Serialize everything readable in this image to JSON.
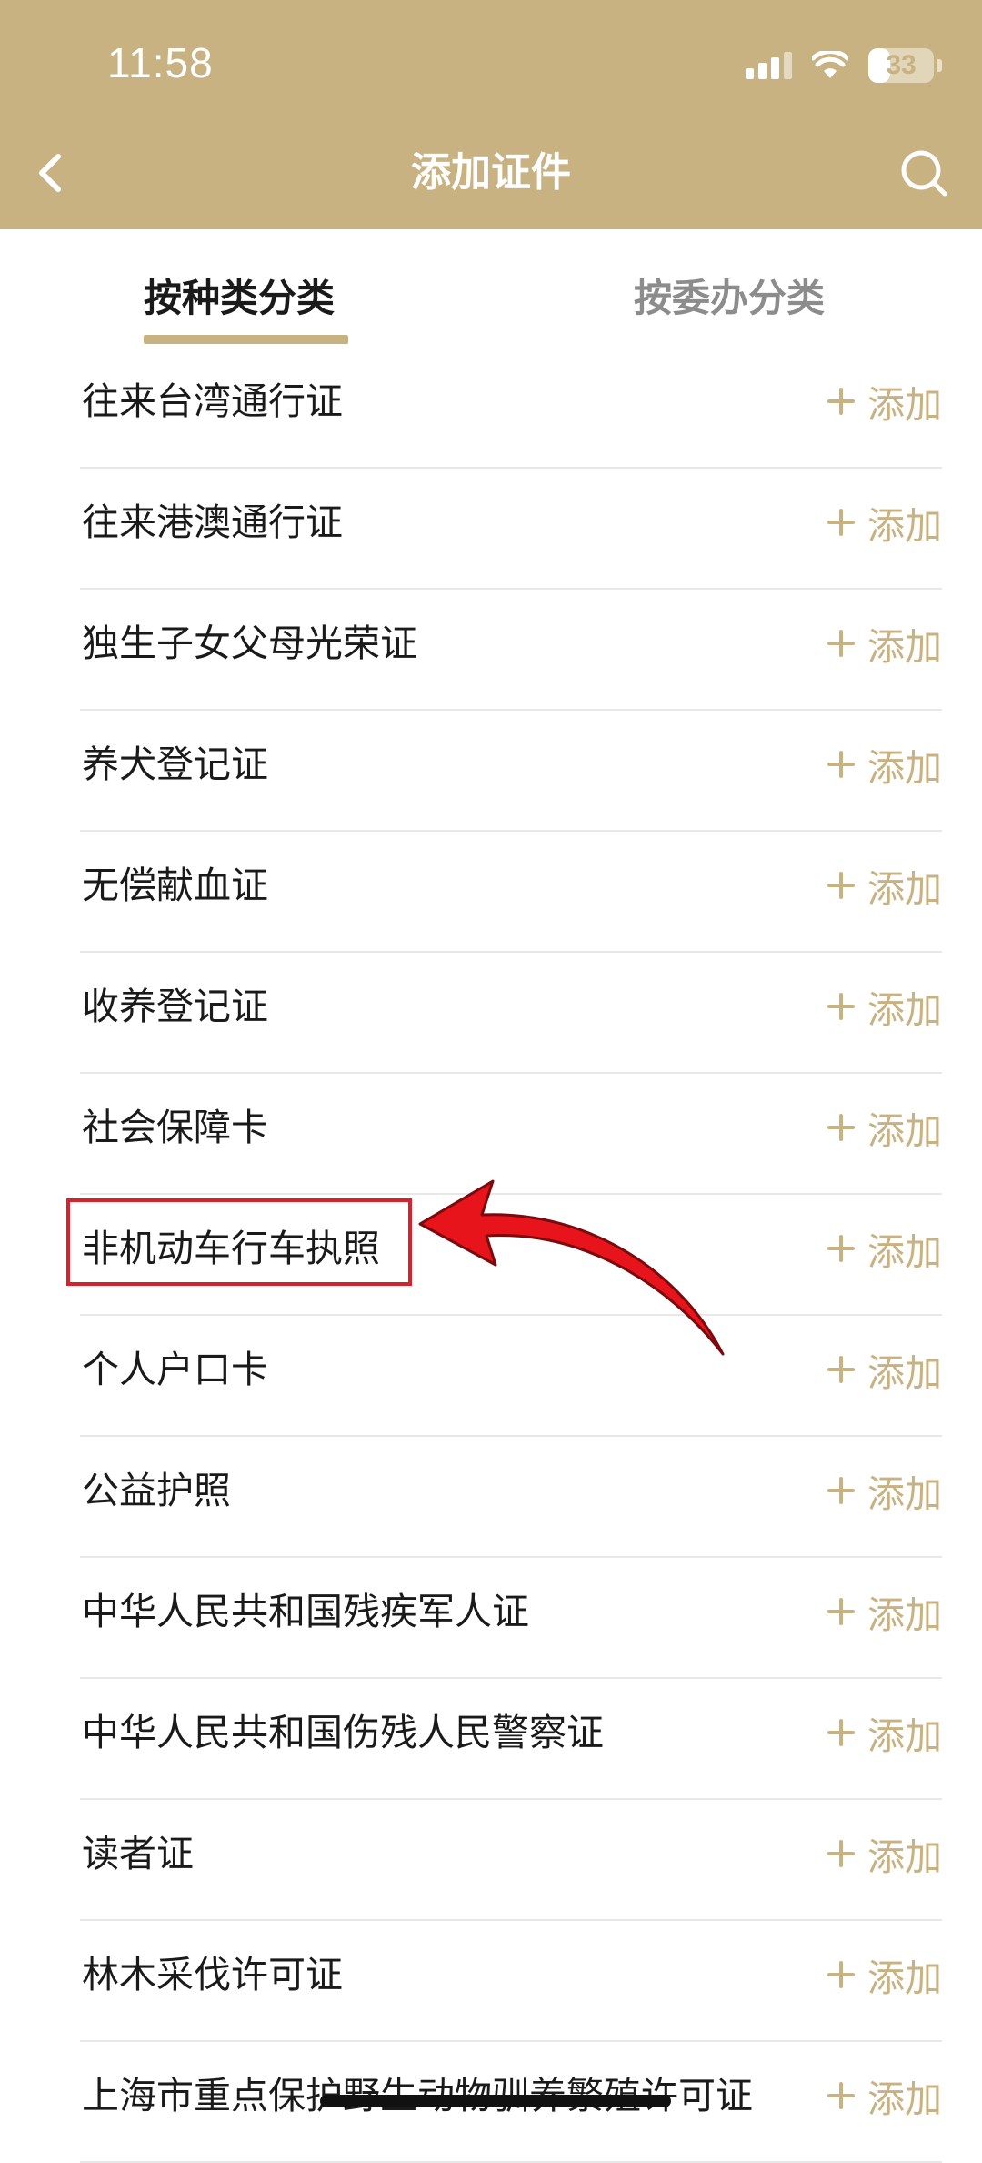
{
  "status_bar": {
    "time": "11:58",
    "battery": "33",
    "battery_level": 0.33
  },
  "nav": {
    "title": "添加证件",
    "back_icon": "chevron-left-icon",
    "search_icon": "search-icon"
  },
  "tabs": [
    {
      "label": "按种类分类",
      "active": true
    },
    {
      "label": "按委办分类",
      "active": false
    }
  ],
  "add_label": "添加",
  "items": [
    {
      "label": "往来台湾通行证"
    },
    {
      "label": "往来港澳通行证"
    },
    {
      "label": "独生子女父母光荣证"
    },
    {
      "label": "养犬登记证"
    },
    {
      "label": "无偿献血证"
    },
    {
      "label": "收养登记证"
    },
    {
      "label": "社会保障卡"
    },
    {
      "label": "非机动车行车执照",
      "highlighted": true
    },
    {
      "label": "个人户口卡"
    },
    {
      "label": "公益护照"
    },
    {
      "label": "中华人民共和国残疾军人证"
    },
    {
      "label": "中华人民共和国伤残人民警察证"
    },
    {
      "label": "读者证"
    },
    {
      "label": "林木采伐许可证"
    },
    {
      "label": "上海市重点保护野生动物驯养繁殖许可证"
    }
  ],
  "colors": {
    "brand": "#C9B282",
    "annotation": "#d8212a"
  }
}
